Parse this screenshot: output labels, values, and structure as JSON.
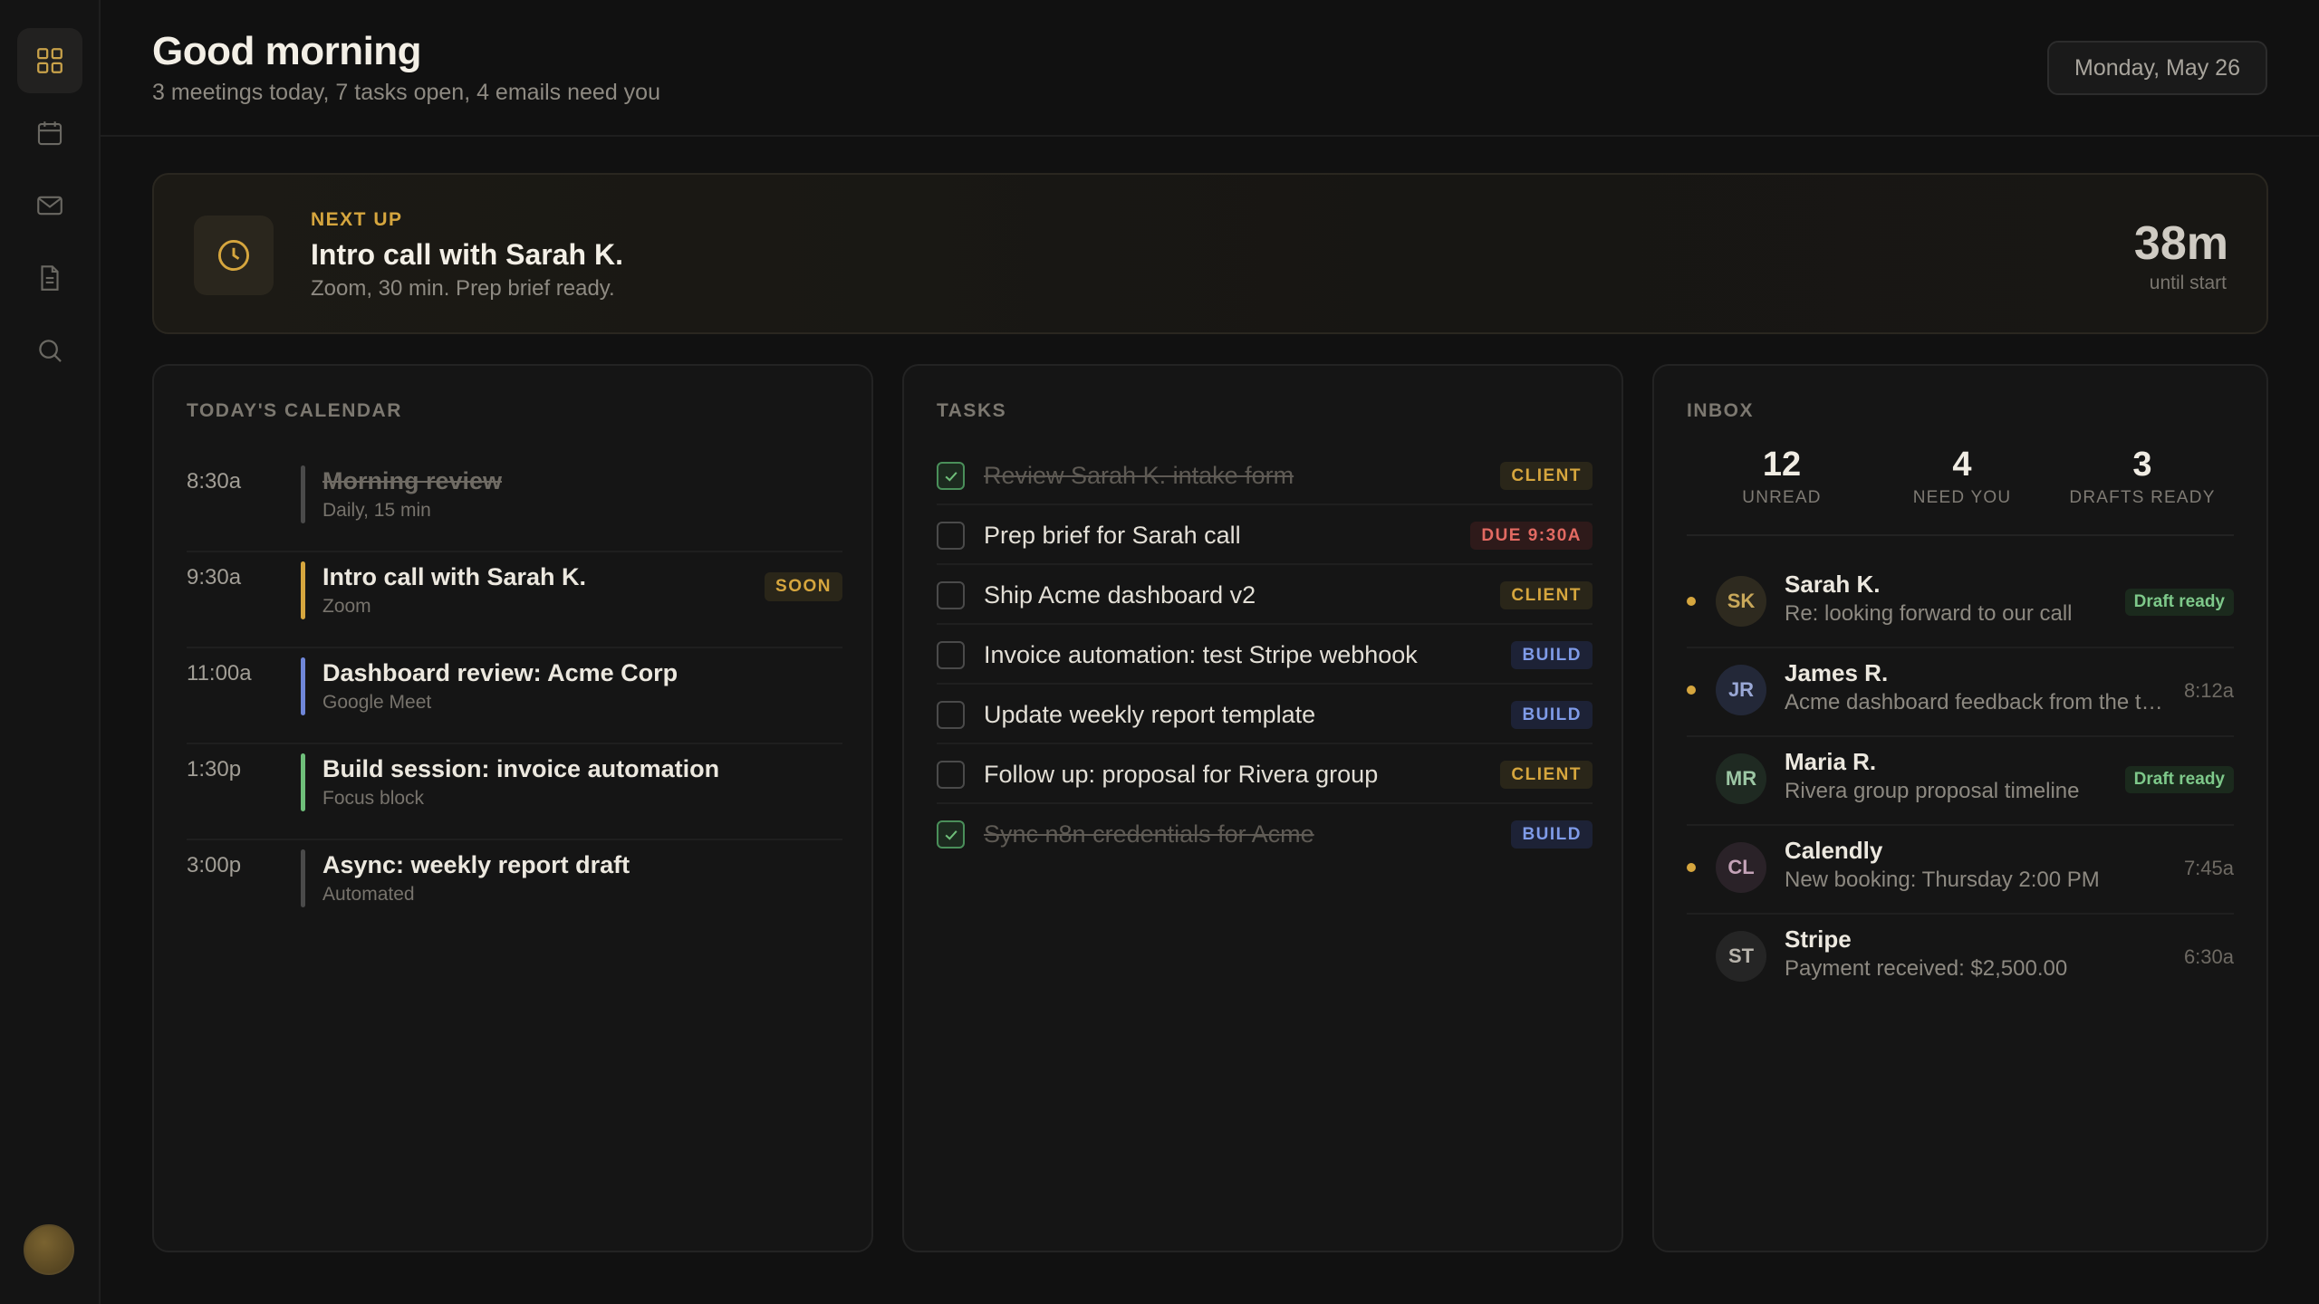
{
  "nav": {
    "items": [
      {
        "name": "dashboard",
        "icon": "grid-icon",
        "active": true
      },
      {
        "name": "calendar",
        "icon": "calendar-icon",
        "active": false
      },
      {
        "name": "mail",
        "icon": "mail-icon",
        "active": false
      },
      {
        "name": "documents",
        "icon": "document-icon",
        "active": false
      },
      {
        "name": "search",
        "icon": "search-icon",
        "active": false
      }
    ]
  },
  "header": {
    "greeting": "Good morning",
    "summary": "3 meetings today, 7 tasks open, 4 emails need you",
    "date": "Monday, May 26"
  },
  "next_up": {
    "label": "NEXT UP",
    "title": "Intro call with Sarah K.",
    "subtitle": "Zoom, 30 min. Prep brief ready.",
    "countdown": "38m",
    "countdown_label": "until start"
  },
  "calendar": {
    "title": "TODAY'S CALENDAR",
    "events": [
      {
        "time": "8:30a",
        "title": "Morning review",
        "sub": "Daily, 15 min",
        "done": true,
        "color": "#4a4a4a",
        "badge": ""
      },
      {
        "time": "9:30a",
        "title": "Intro call with Sarah K.",
        "sub": "Zoom",
        "done": false,
        "color": "#d6a63e",
        "badge": "SOON"
      },
      {
        "time": "11:00a",
        "title": "Dashboard review: Acme Corp",
        "sub": "Google Meet",
        "done": false,
        "color": "#6f86d8",
        "badge": ""
      },
      {
        "time": "1:30p",
        "title": "Build session: invoice automation",
        "sub": "Focus block",
        "done": false,
        "color": "#6fbf7a",
        "badge": ""
      },
      {
        "time": "3:00p",
        "title": "Async: weekly report draft",
        "sub": "Automated",
        "done": false,
        "color": "#4a4a4a",
        "badge": ""
      }
    ]
  },
  "tasks": {
    "title": "TASKS",
    "items": [
      {
        "text": "Review Sarah K. intake form",
        "done": true,
        "tag": "CLIENT",
        "tag_type": "client"
      },
      {
        "text": "Prep brief for Sarah call",
        "done": false,
        "tag": "DUE 9:30A",
        "tag_type": "due"
      },
      {
        "text": "Ship Acme dashboard v2",
        "done": false,
        "tag": "CLIENT",
        "tag_type": "client"
      },
      {
        "text": "Invoice automation: test Stripe webhook",
        "done": false,
        "tag": "BUILD",
        "tag_type": "build"
      },
      {
        "text": "Update weekly report template",
        "done": false,
        "tag": "BUILD",
        "tag_type": "build"
      },
      {
        "text": "Follow up: proposal for Rivera group",
        "done": false,
        "tag": "CLIENT",
        "tag_type": "client"
      },
      {
        "text": "Sync n8n credentials for Acme",
        "done": true,
        "tag": "BUILD",
        "tag_type": "build"
      }
    ]
  },
  "inbox": {
    "title": "INBOX",
    "stats": [
      {
        "value": "12",
        "label": "UNREAD"
      },
      {
        "value": "4",
        "label": "NEED YOU"
      },
      {
        "value": "3",
        "label": "DRAFTS READY"
      }
    ],
    "messages": [
      {
        "initials": "SK",
        "from": "Sarah K.",
        "subject": "Re: looking forward to our call",
        "unread": true,
        "time": "",
        "badge": "Draft ready",
        "avatar_bg": "#2e2a1f",
        "avatar_fg": "#c9a85a"
      },
      {
        "initials": "JR",
        "from": "James R.",
        "subject": "Acme dashboard feedback from the team",
        "unread": true,
        "time": "8:12a",
        "badge": "",
        "avatar_bg": "#232838",
        "avatar_fg": "#9aa8d6"
      },
      {
        "initials": "MR",
        "from": "Maria R.",
        "subject": "Rivera group proposal timeline",
        "unread": false,
        "time": "",
        "badge": "Draft ready",
        "avatar_bg": "#1f2a22",
        "avatar_fg": "#9cc7a4"
      },
      {
        "initials": "CL",
        "from": "Calendly",
        "subject": "New booking: Thursday 2:00 PM",
        "unread": true,
        "time": "7:45a",
        "badge": "",
        "avatar_bg": "#2a2228",
        "avatar_fg": "#c4a3b8"
      },
      {
        "initials": "ST",
        "from": "Stripe",
        "subject": "Payment received: $2,500.00",
        "unread": false,
        "time": "6:30a",
        "badge": "",
        "avatar_bg": "#252525",
        "avatar_fg": "#b8b4ac"
      }
    ]
  }
}
